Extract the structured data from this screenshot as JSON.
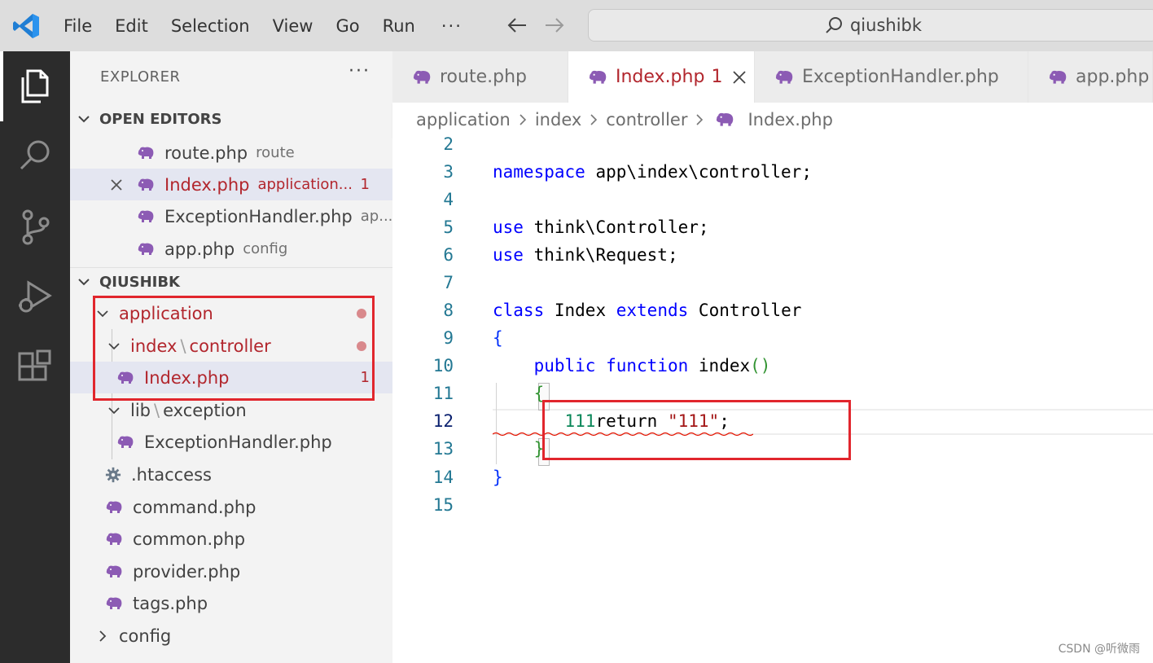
{
  "titlebar": {
    "menu": [
      "File",
      "Edit",
      "Selection",
      "View",
      "Go",
      "Run"
    ],
    "more": "···",
    "command_center": "qiushibk"
  },
  "activity_icons": [
    "explorer-icon",
    "search-icon",
    "source-control-icon",
    "run-debug-icon",
    "extensions-icon"
  ],
  "sidebar": {
    "title": "EXPLORER",
    "more": "···",
    "open_editors": {
      "title": "OPEN EDITORS",
      "items": [
        {
          "name": "route.php",
          "desc": "route"
        },
        {
          "name": "Index.php",
          "desc": "application...",
          "badge": "1"
        },
        {
          "name": "ExceptionHandler.php",
          "desc": "ap..."
        },
        {
          "name": "app.php",
          "desc": "config"
        }
      ]
    },
    "workspace": {
      "title": "QIUSHIBK",
      "tree": [
        {
          "label": "application"
        },
        {
          "label_a": "index",
          "label_b": "controller"
        },
        {
          "label": "Index.php",
          "badge": "1"
        },
        {
          "label_a": "lib",
          "label_b": "exception"
        },
        {
          "label": "ExceptionHandler.php"
        },
        {
          "label": ".htaccess"
        },
        {
          "label": "command.php"
        },
        {
          "label": "common.php"
        },
        {
          "label": "provider.php"
        },
        {
          "label": "tags.php"
        },
        {
          "label": "config"
        }
      ],
      "separator": "\\"
    }
  },
  "tabs": [
    {
      "label": "route.php"
    },
    {
      "label": "Index.php",
      "badge": "1"
    },
    {
      "label": "ExceptionHandler.php"
    },
    {
      "label": "app.php"
    }
  ],
  "breadcrumbs": [
    "application",
    "index",
    "controller",
    "Index.php"
  ],
  "editor": {
    "line_numbers": [
      "2",
      "3",
      "4",
      "5",
      "6",
      "7",
      "8",
      "9",
      "10",
      "11",
      "12",
      "13",
      "14",
      "15"
    ],
    "tokens": {
      "namespace": "namespace",
      "namespace_path": "app\\index\\controller;",
      "use": "use",
      "use1": "think\\Controller;",
      "use2": "think\\Request;",
      "class": "class",
      "class_name": "Index",
      "extends": "extends",
      "parent": "Controller",
      "open_brace": "{",
      "public": "public",
      "function": "function",
      "fn_name": "index",
      "paren_open": "(",
      "paren_close": ")",
      "inner_open": "{",
      "num": "111",
      "ret": "return",
      "str": "\"111\"",
      "semi": ";",
      "inner_close": "}",
      "close_brace": "}"
    }
  },
  "watermark": "CSDN @听微雨",
  "colors": {
    "accent_error": "#b2262d",
    "annotation": "#e1262d",
    "keyword": "#0000ff",
    "string": "#a31515",
    "number": "#098658",
    "activity_bar": "#2c2c2c"
  }
}
